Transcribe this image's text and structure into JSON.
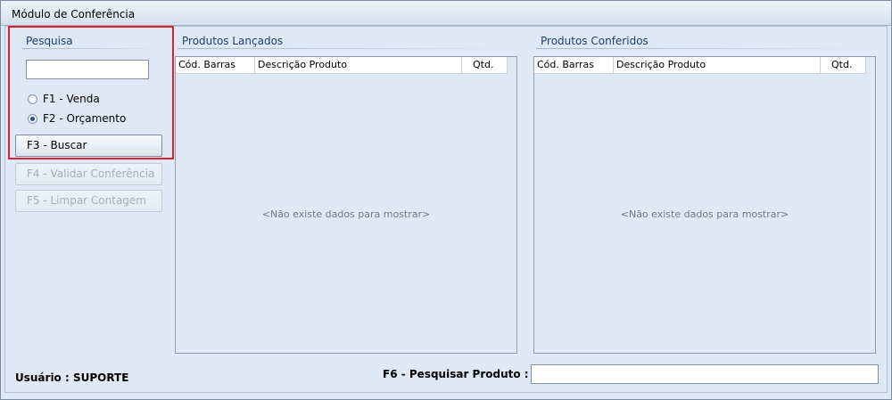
{
  "window": {
    "title": "Módulo de Conferência"
  },
  "search_panel": {
    "title": "Pesquisa",
    "input_value": "",
    "options": [
      {
        "label": "F1 - Venda",
        "checked": false
      },
      {
        "label": "F2 - Orçamento",
        "checked": true
      }
    ],
    "buttons": {
      "buscar": "F3 - Buscar",
      "validar": "F4 - Validar Conferência",
      "limpar": "F5 - Limpar Contagem"
    }
  },
  "grids": {
    "lancados": {
      "title": "Produtos Lançados",
      "columns": [
        "Cód. Barras",
        "Descrição Produto",
        "Qtd."
      ],
      "empty_text": "<Não existe dados para mostrar>"
    },
    "conferidos": {
      "title": "Produtos Conferidos",
      "columns": [
        "Cód. Barras",
        "Descrição Produto",
        "Qtd."
      ],
      "empty_text": "<Não existe dados para mostrar>"
    }
  },
  "footer": {
    "user_label": "Usuário : SUPORTE",
    "search_product_label": "F6 - Pesquisar Produto :",
    "search_product_value": ""
  },
  "colors": {
    "highlight": "#e0202a",
    "group_title": "#1f3f6e"
  }
}
